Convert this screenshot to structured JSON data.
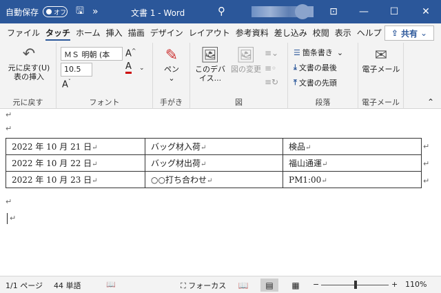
{
  "titlebar": {
    "autosave_label": "自動保存",
    "autosave_state": "オフ",
    "doc_title": "文書 1  -  Word",
    "more_label": "»"
  },
  "tabs": [
    "ファイル",
    "タッチ",
    "ホーム",
    "挿入",
    "描画",
    "デザイン",
    "レイアウト",
    "参考資料",
    "差し込み",
    "校閲",
    "表示",
    "ヘルプ"
  ],
  "active_tab": "タッチ",
  "share_label": "共有",
  "ribbon": {
    "undo": {
      "line1": "元に戻す(U)",
      "line2": "表の挿入",
      "group": "元に戻す"
    },
    "font": {
      "name": "ＭＳ 明朝 (本",
      "size": "10.5",
      "group": "フォント"
    },
    "pen": {
      "label": "ペン",
      "group": "手がき"
    },
    "image": {
      "device_line1": "このデバ",
      "device_line2": "イス...",
      "change": "図の変更",
      "group": "図"
    },
    "paragraph": {
      "bullets": "箇条書き",
      "to_end": "文書の最後",
      "to_start": "文書の先頭",
      "group": "段落"
    },
    "email": {
      "label": "電子メール",
      "group": "電子メール"
    }
  },
  "document": {
    "table": [
      [
        "2022 年 10 月 21 日",
        "バッグ材入荷",
        "検品"
      ],
      [
        "2022 年 10 月 22 日",
        "バッグ材出荷",
        "福山通運"
      ],
      [
        "2022 年 10 月 23 日",
        "○○打ち合わせ",
        "PM1:00"
      ]
    ],
    "para_mark": "↵"
  },
  "status": {
    "page": "1/1 ページ",
    "words": "44 単語",
    "focus": "フォーカス",
    "zoom": "110%"
  },
  "colors": {
    "accent": "#2b579a"
  }
}
